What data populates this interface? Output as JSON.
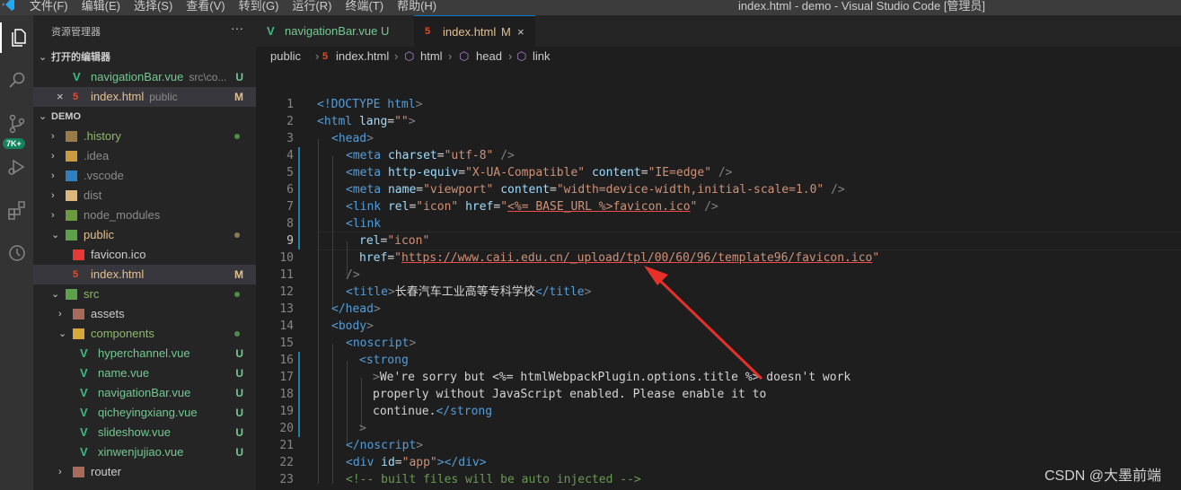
{
  "menu": [
    "文件(F)",
    "编辑(E)",
    "选择(S)",
    "查看(V)",
    "转到(G)",
    "运行(R)",
    "终端(T)",
    "帮助(H)"
  ],
  "window_title": "index.html - demo - Visual Studio Code [管理员]",
  "activity": {
    "badge": "7K+"
  },
  "explorer": {
    "title": "资源管理器",
    "more": "···",
    "open_editors_header": "打开的编辑器",
    "open_editors": [
      {
        "name": "navigationBar.vue",
        "desc": "src\\co...",
        "status": "U"
      },
      {
        "name": "index.html",
        "desc": "public",
        "status": "M",
        "close": "×"
      }
    ],
    "project": "DEMO",
    "tree": [
      {
        "name": ".history"
      },
      {
        "name": ".idea"
      },
      {
        "name": ".vscode"
      },
      {
        "name": "dist"
      },
      {
        "name": "node_modules"
      },
      {
        "name": "public"
      },
      {
        "name": "favicon.ico"
      },
      {
        "name": "index.html",
        "status": "M"
      },
      {
        "name": "src"
      },
      {
        "name": "assets"
      },
      {
        "name": "components"
      },
      {
        "name": "hyperchannel.vue",
        "status": "U"
      },
      {
        "name": "name.vue",
        "status": "U"
      },
      {
        "name": "navigationBar.vue",
        "status": "U"
      },
      {
        "name": "qicheyingxiang.vue",
        "status": "U"
      },
      {
        "name": "slideshow.vue",
        "status": "U"
      },
      {
        "name": "xinwenjujiao.vue",
        "status": "U"
      },
      {
        "name": "router"
      }
    ]
  },
  "tabs": [
    {
      "label": "navigationBar.vue",
      "status": "U"
    },
    {
      "label": "index.html",
      "status": "M",
      "close": "×"
    }
  ],
  "breadcrumb": [
    "public",
    "index.html",
    "html",
    "head",
    "link"
  ],
  "code": {
    "line_numbers": [
      "1",
      "2",
      "3",
      "4",
      "5",
      "6",
      "7",
      "8",
      "9",
      "10",
      "11",
      "12",
      "13",
      "14",
      "15",
      "16",
      "17",
      "18",
      "19",
      "20",
      "21",
      "22",
      "23"
    ],
    "l1": [
      "<!DOCTYPE",
      " html",
      ">"
    ],
    "l2": [
      "<html",
      " lang",
      "=",
      "\"\"",
      ">"
    ],
    "l3": [
      "<head",
      ">"
    ],
    "l4": [
      "<meta",
      " charset",
      "=",
      "\"utf-8\"",
      " />"
    ],
    "l5": [
      "<meta",
      " http-equiv",
      "=",
      "\"X-UA-Compatible\"",
      " content",
      "=",
      "\"IE=edge\"",
      " />"
    ],
    "l6": [
      "<meta",
      " name",
      "=",
      "\"viewport\"",
      " content",
      "=",
      "\"width=device-width,initial-scale=1.0\"",
      " />"
    ],
    "l7": [
      "<link",
      " rel",
      "=",
      "\"icon\"",
      " href",
      "=",
      "\"",
      "<%= BASE_URL %>favicon.ico",
      "\"",
      " />"
    ],
    "l8": [
      "<link"
    ],
    "l9": [
      "rel",
      "=",
      "\"icon\""
    ],
    "l10": [
      "href",
      "=",
      "\"",
      "https://www.caii.edu.cn/_upload/tpl/00/60/96/template96/favicon.ico",
      "\""
    ],
    "l11": [
      "/>"
    ],
    "l12": [
      "<title",
      ">",
      "长春汽车工业高等专科学校",
      "</title",
      ">"
    ],
    "l13": [
      "</head",
      ">"
    ],
    "l14": [
      "<body",
      ">"
    ],
    "l15": [
      "<noscript",
      ">"
    ],
    "l16": [
      "<strong"
    ],
    "l17": [
      ">",
      "We're sorry but ",
      "<%= htmlWebpackPlugin.options.title %>",
      " doesn't work"
    ],
    "l18": [
      "properly without JavaScript enabled. Please enable it to"
    ],
    "l19": [
      "continue.",
      "</strong"
    ],
    "l20": [
      ">"
    ],
    "l21": [
      "</noscript",
      ">"
    ],
    "l22": [
      "<div",
      " id",
      "=",
      "\"app\"",
      "></div>"
    ],
    "l23": [
      "<!-- built files will be auto injected -->"
    ]
  },
  "watermark": "CSDN @大墨前端",
  "colors": {
    "accent": "#007acc",
    "untracked": "#73c991",
    "modified": "#e2c08d",
    "annotation_arrow": "#e8302a"
  }
}
